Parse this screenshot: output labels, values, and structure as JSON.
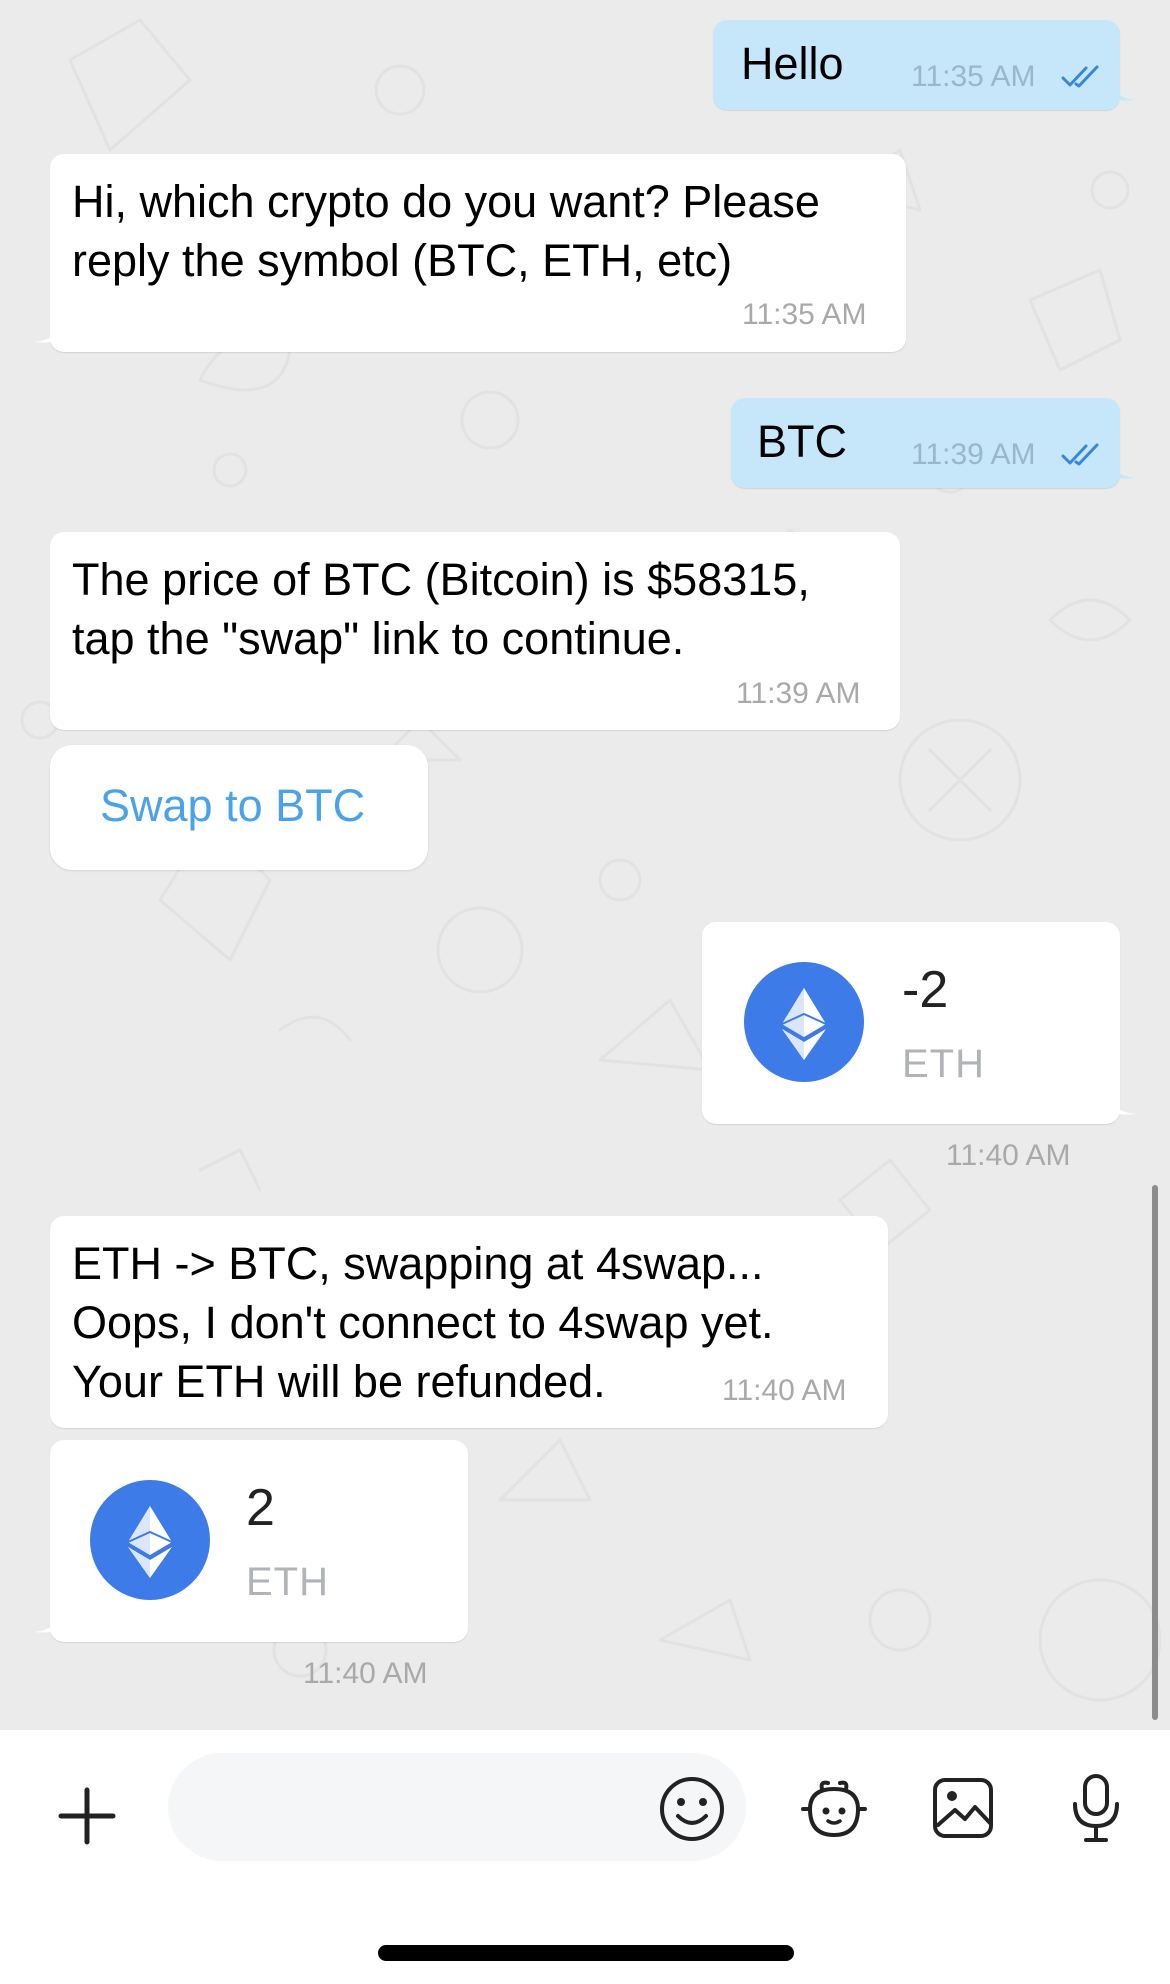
{
  "messages": [
    {
      "direction": "sent",
      "text": "Hello",
      "time": "11:35 AM"
    },
    {
      "direction": "received",
      "lines": [
        "Hi, which crypto do you want? Please",
        "reply the symbol (BTC, ETH, etc)"
      ],
      "time": "11:35 AM"
    },
    {
      "direction": "sent",
      "text": "BTC",
      "time": "11:39 AM"
    },
    {
      "direction": "received",
      "lines": [
        "The price of BTC (Bitcoin) is $58315,",
        "tap the \"swap\" link to continue."
      ],
      "time": "11:39 AM"
    },
    {
      "direction": "received",
      "type": "button",
      "label": "Swap to BTC"
    },
    {
      "direction": "sent",
      "type": "transfer",
      "amount": "-2",
      "symbol": "ETH",
      "icon": "ethereum-icon",
      "time": "11:40 AM"
    },
    {
      "direction": "received",
      "lines": [
        "ETH -> BTC, swapping at 4swap...",
        "Oops, I don't connect to 4swap yet.",
        "Your ETH will be refunded."
      ],
      "time": "11:40 AM"
    },
    {
      "direction": "received",
      "type": "transfer",
      "amount": "2",
      "symbol": "ETH",
      "icon": "ethereum-icon",
      "time": "11:40 AM"
    }
  ],
  "composer": {
    "placeholder": "",
    "icons": [
      "plus-icon",
      "emoji-icon",
      "bot-icon",
      "image-icon",
      "microphone-icon"
    ]
  },
  "colors": {
    "sent_bubble": "#c6e7fa",
    "received_bubble": "#ffffff",
    "chat_background": "#ebebeb",
    "link": "#4aa3e9",
    "read_ticks": "#3a86d8",
    "eth_coin": "#3d7be8"
  }
}
